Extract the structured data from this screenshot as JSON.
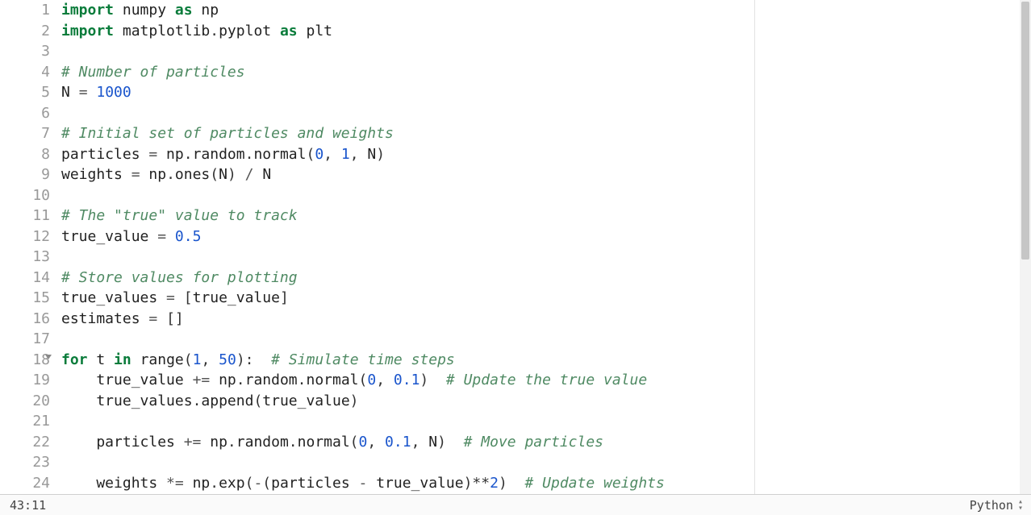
{
  "gutter": {
    "lines": [
      "1",
      "2",
      "3",
      "4",
      "5",
      "6",
      "7",
      "8",
      "9",
      "10",
      "11",
      "12",
      "13",
      "14",
      "15",
      "16",
      "17",
      "18",
      "19",
      "20",
      "21",
      "22",
      "23",
      "24"
    ],
    "fold_line": 18
  },
  "code": {
    "lines": [
      [
        [
          "kw",
          "import"
        ],
        [
          "ident",
          " numpy "
        ],
        [
          "kw",
          "as"
        ],
        [
          "ident",
          " np"
        ]
      ],
      [
        [
          "kw",
          "import"
        ],
        [
          "ident",
          " matplotlib"
        ],
        [
          "punct",
          "."
        ],
        [
          "ident",
          "pyplot "
        ],
        [
          "kw",
          "as"
        ],
        [
          "ident",
          " plt"
        ]
      ],
      [],
      [
        [
          "comm",
          "# Number of particles"
        ]
      ],
      [
        [
          "ident",
          "N "
        ],
        [
          "op",
          "="
        ],
        [
          "ident",
          " "
        ],
        [
          "num",
          "1000"
        ]
      ],
      [],
      [
        [
          "comm",
          "# Initial set of particles and weights"
        ]
      ],
      [
        [
          "ident",
          "particles "
        ],
        [
          "op",
          "="
        ],
        [
          "ident",
          " np"
        ],
        [
          "punct",
          "."
        ],
        [
          "ident",
          "random"
        ],
        [
          "punct",
          "."
        ],
        [
          "func",
          "normal"
        ],
        [
          "punct",
          "("
        ],
        [
          "num",
          "0"
        ],
        [
          "punct",
          ", "
        ],
        [
          "num",
          "1"
        ],
        [
          "punct",
          ", "
        ],
        [
          "ident",
          "N"
        ],
        [
          "punct",
          ")"
        ]
      ],
      [
        [
          "ident",
          "weights "
        ],
        [
          "op",
          "="
        ],
        [
          "ident",
          " np"
        ],
        [
          "punct",
          "."
        ],
        [
          "func",
          "ones"
        ],
        [
          "punct",
          "("
        ],
        [
          "ident",
          "N"
        ],
        [
          "punct",
          ") "
        ],
        [
          "op",
          "/"
        ],
        [
          "ident",
          " N"
        ]
      ],
      [],
      [
        [
          "comm",
          "# The \"true\" value to track"
        ]
      ],
      [
        [
          "ident",
          "true_value "
        ],
        [
          "op",
          "="
        ],
        [
          "ident",
          " "
        ],
        [
          "num",
          "0.5"
        ]
      ],
      [],
      [
        [
          "comm",
          "# Store values for plotting"
        ]
      ],
      [
        [
          "ident",
          "true_values "
        ],
        [
          "op",
          "="
        ],
        [
          "ident",
          " "
        ],
        [
          "punct",
          "["
        ],
        [
          "ident",
          "true_value"
        ],
        [
          "punct",
          "]"
        ]
      ],
      [
        [
          "ident",
          "estimates "
        ],
        [
          "op",
          "="
        ],
        [
          "ident",
          " "
        ],
        [
          "punct",
          "[]"
        ]
      ],
      [],
      [
        [
          "kw",
          "for"
        ],
        [
          "ident",
          " t "
        ],
        [
          "kw",
          "in"
        ],
        [
          "ident",
          " "
        ],
        [
          "func",
          "range"
        ],
        [
          "punct",
          "("
        ],
        [
          "num",
          "1"
        ],
        [
          "punct",
          ", "
        ],
        [
          "num",
          "50"
        ],
        [
          "punct",
          "):  "
        ],
        [
          "comm",
          "# Simulate time steps"
        ]
      ],
      [
        [
          "ident",
          "    true_value "
        ],
        [
          "op",
          "+="
        ],
        [
          "ident",
          " np"
        ],
        [
          "punct",
          "."
        ],
        [
          "ident",
          "random"
        ],
        [
          "punct",
          "."
        ],
        [
          "func",
          "normal"
        ],
        [
          "punct",
          "("
        ],
        [
          "num",
          "0"
        ],
        [
          "punct",
          ", "
        ],
        [
          "num",
          "0.1"
        ],
        [
          "punct",
          ")  "
        ],
        [
          "comm",
          "# Update the true value"
        ]
      ],
      [
        [
          "ident",
          "    true_values"
        ],
        [
          "punct",
          "."
        ],
        [
          "func",
          "append"
        ],
        [
          "punct",
          "("
        ],
        [
          "ident",
          "true_value"
        ],
        [
          "punct",
          ")"
        ]
      ],
      [],
      [
        [
          "ident",
          "    particles "
        ],
        [
          "op",
          "+="
        ],
        [
          "ident",
          " np"
        ],
        [
          "punct",
          "."
        ],
        [
          "ident",
          "random"
        ],
        [
          "punct",
          "."
        ],
        [
          "func",
          "normal"
        ],
        [
          "punct",
          "("
        ],
        [
          "num",
          "0"
        ],
        [
          "punct",
          ", "
        ],
        [
          "num",
          "0.1"
        ],
        [
          "punct",
          ", "
        ],
        [
          "ident",
          "N"
        ],
        [
          "punct",
          ")  "
        ],
        [
          "comm",
          "# Move particles"
        ]
      ],
      [],
      [
        [
          "ident",
          "    weights "
        ],
        [
          "op",
          "*="
        ],
        [
          "ident",
          " np"
        ],
        [
          "punct",
          "."
        ],
        [
          "func",
          "exp"
        ],
        [
          "punct",
          "("
        ],
        [
          "op",
          "-"
        ],
        [
          "punct",
          "("
        ],
        [
          "ident",
          "particles "
        ],
        [
          "op",
          "-"
        ],
        [
          "ident",
          " true_value"
        ],
        [
          "punct",
          ")"
        ],
        [
          "star",
          "**"
        ],
        [
          "num",
          "2"
        ],
        [
          "punct",
          ")  "
        ],
        [
          "comm",
          "# Update weights"
        ]
      ]
    ]
  },
  "status": {
    "cursor": "43:11",
    "language": "Python"
  }
}
